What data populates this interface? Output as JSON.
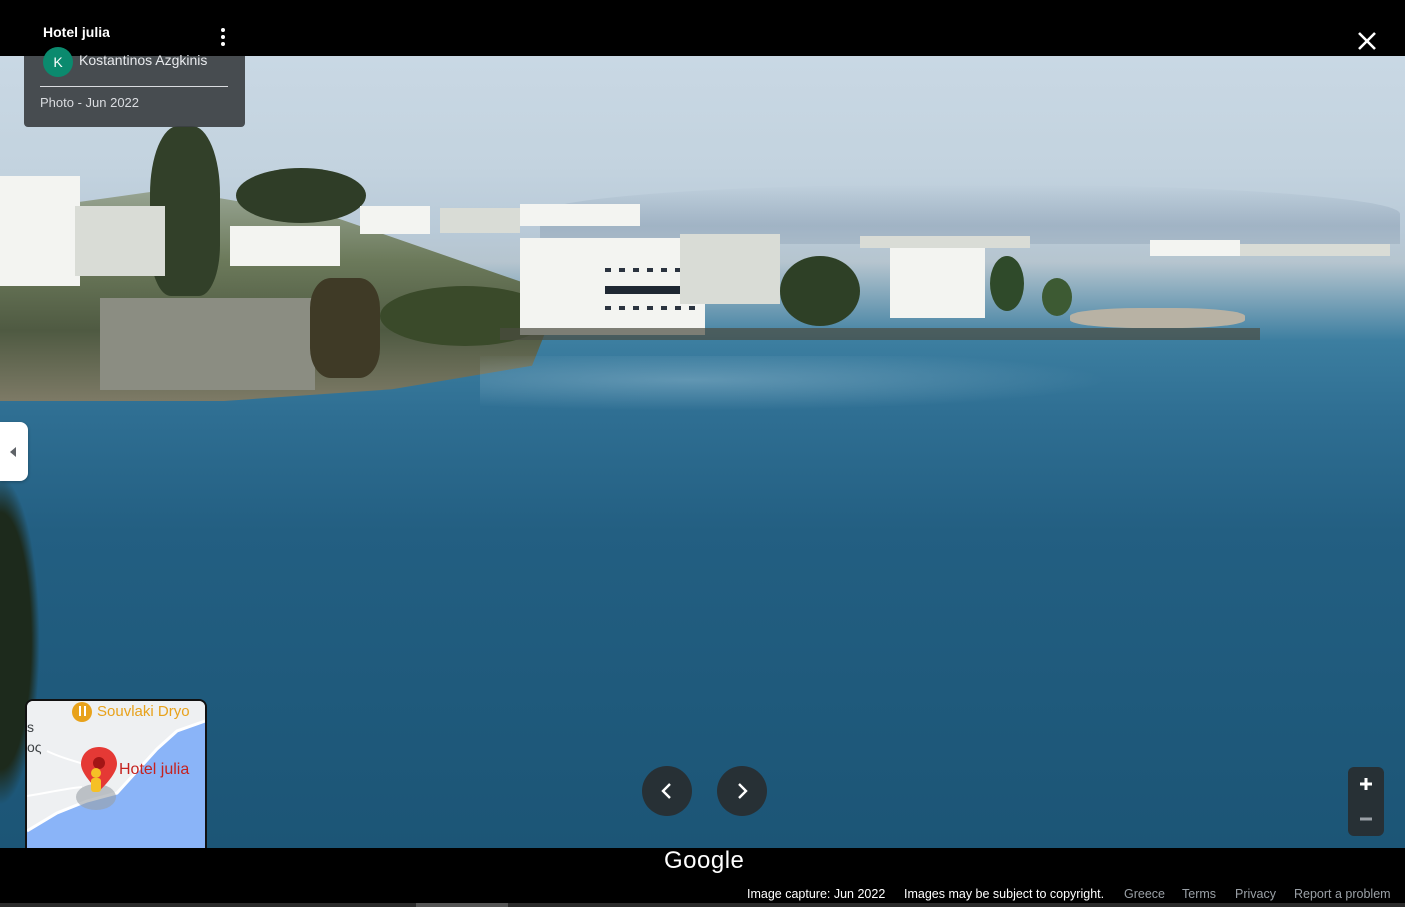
{
  "header": {
    "place_title": "Hotel julia",
    "author_initial": "K",
    "author_name": "Kostantinos Azgkinis",
    "photo_date": "Photo - Jun 2022"
  },
  "icons": {
    "more": "more-vert-icon",
    "close": "close-icon",
    "collapse": "caret-left-icon",
    "prev": "chevron-left-icon",
    "next": "chevron-right-icon",
    "zoom_in": "plus-icon",
    "zoom_out": "minus-icon"
  },
  "minimap": {
    "poi_label": "Souvlaki Dryo",
    "place_label": "Hotel julia",
    "edge_text_1": "s",
    "edge_text_2": "ος"
  },
  "branding": {
    "logo": "Google"
  },
  "footer": {
    "capture": "Image capture: Jun 2022",
    "copyright": "Images may be subject to copyright.",
    "country": "Greece",
    "terms": "Terms",
    "privacy": "Privacy",
    "report": "Report a problem"
  },
  "colors": {
    "avatar": "#0b8a6e",
    "pin": "#e53935",
    "poi": "#e8a21b",
    "water": "#8ab4f8"
  }
}
